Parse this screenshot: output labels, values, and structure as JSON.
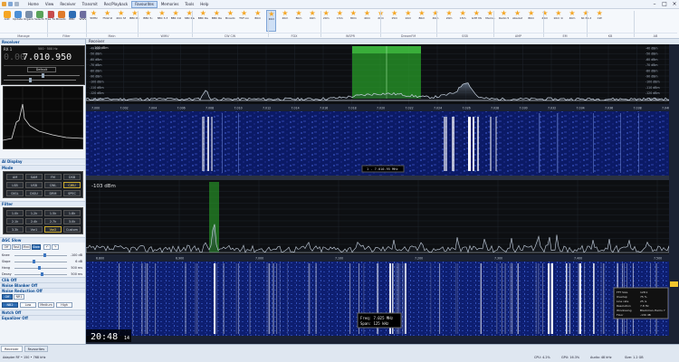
{
  "menu": {
    "items": [
      "Home",
      "View",
      "Receiver",
      "Transmit",
      "Rec/Playback",
      "Favourites",
      "Memories",
      "Tools",
      "Help"
    ],
    "active_index": 5
  },
  "ribbon": {
    "buttons": [
      {
        "label": "Add",
        "icon": "add-star-icon"
      },
      {
        "label": "Update",
        "icon": "update-icon"
      },
      {
        "label": "Organise",
        "icon": "organise-icon"
      },
      {
        "label": "Selection",
        "icon": "selection-icon"
      },
      {
        "label": "Free Tune",
        "icon": "free-tune-icon"
      },
      {
        "label": "Broadcast Amateur",
        "icon": "broadcast-icon"
      },
      {
        "label": "BBC",
        "icon": "bbc-icon"
      },
      {
        "label": "WWV",
        "icon": "wwv-icon"
      },
      {
        "label": "5MHz",
        "icon": "star-icon"
      },
      {
        "label": "7542 kHz",
        "icon": "star-icon"
      },
      {
        "label": "40m SSB",
        "icon": "star-icon"
      },
      {
        "label": "BBC R.4 LW",
        "icon": "star-icon"
      },
      {
        "label": "BBC 5.277",
        "icon": "star-icon"
      },
      {
        "label": "BBC 3.3",
        "icon": "star-icon"
      },
      {
        "label": "BBC 198.5",
        "icon": "star-icon"
      },
      {
        "label": "SBC Radio 1",
        "icon": "star-icon"
      },
      {
        "label": "BBC Radio Cornwall",
        "icon": "star-icon"
      },
      {
        "label": "BBC Radio 2 103.9",
        "icon": "star-icon"
      },
      {
        "label": "Broadcast FM x5",
        "icon": "star-icon"
      },
      {
        "label": "TSF Live",
        "icon": "star-icon"
      },
      {
        "label": "80m",
        "icon": "star-icon"
      },
      {
        "label": "40m",
        "icon": "star-icon"
      },
      {
        "label": "20m",
        "icon": "star-icon"
      },
      {
        "label": "80m",
        "icon": "star-icon"
      },
      {
        "label": "40m",
        "icon": "star-icon"
      },
      {
        "label": "20m",
        "icon": "star-icon"
      },
      {
        "label": "15m",
        "icon": "star-icon"
      },
      {
        "label": "80m",
        "icon": "star-icon"
      },
      {
        "label": "40m",
        "icon": "star-icon"
      },
      {
        "label": "20m",
        "icon": "star-icon"
      },
      {
        "label": "15m",
        "icon": "star-icon"
      },
      {
        "label": "10m",
        "icon": "star-icon"
      },
      {
        "label": "80m",
        "icon": "star-icon"
      },
      {
        "label": "40m",
        "icon": "star-icon"
      },
      {
        "label": "20m",
        "icon": "star-icon"
      },
      {
        "label": "15m",
        "icon": "star-icon"
      },
      {
        "label": "G3H Marina",
        "icon": "star-icon"
      },
      {
        "label": "Marina",
        "icon": "star-icon"
      },
      {
        "label": "Radio 5 Live",
        "icon": "star-icon"
      },
      {
        "label": "Absolute Radio",
        "icon": "star-icon"
      },
      {
        "label": "80m",
        "icon": "star-icon"
      },
      {
        "label": "20m",
        "icon": "star-icon"
      },
      {
        "label": "10m 14.9 MHz",
        "icon": "star-icon"
      },
      {
        "label": "40m",
        "icon": "star-icon"
      },
      {
        "label": "SK 31.2 kHz",
        "icon": "star-icon"
      },
      {
        "label": "CW",
        "icon": "star-icon"
      }
    ],
    "selected_index": 21,
    "groups": [
      "Manage",
      "Filter",
      "Main",
      "WWV",
      "CW CW",
      "FDX",
      "WSPR",
      "DreamFM",
      "SSB",
      "AMP",
      "EM",
      "KB",
      "AB"
    ]
  },
  "leftpanel": {
    "receiver_title": "Receiver",
    "rx_label": "RX 1",
    "vfo_text": "7.010.950",
    "vfo_dim": "0.00",
    "vfo_sub": "500 · 500 Hz",
    "preset": "Default",
    "display_title": "AI Display",
    "mode_title": "Mode",
    "modes": [
      "AM",
      "SAM",
      "FM",
      "DSB",
      "LSB",
      "USB",
      "CWL",
      "CWU",
      "DIGL",
      "DIGU",
      "DRM",
      "SPEC"
    ],
    "active_mode": 7,
    "filter_title": "Filter",
    "filters": [
      "1.0k",
      "1.2k",
      "1.5k",
      "1.8k",
      "2.1k",
      "2.4k",
      "2.7k",
      "3.0k",
      "3.3k",
      "Var1",
      "Var2",
      "Custom"
    ],
    "active_filter": 10,
    "agc_title": "AGC Slow",
    "agc_buttons": [
      "Off",
      "Fast",
      "Med",
      "Slow"
    ],
    "agc_active": 3,
    "sliders": [
      {
        "label": "Knee",
        "value": "-100 dB",
        "pos": 0.55
      },
      {
        "label": "Slope",
        "value": "6 dB",
        "pos": 0.35
      },
      {
        "label": "Hang",
        "value": "500 ms",
        "pos": 0.45
      },
      {
        "label": "Decay",
        "value": "500 ms",
        "pos": 0.5
      }
    ],
    "cw_title": "Clik Off",
    "noise_title": "Noise Blanker Off",
    "nr_title": "Noise Reduction Off",
    "nr_buttons": [
      "Off",
      "NR1"
    ],
    "nb_levels": [
      "NB2",
      "Low",
      "Medium",
      "High"
    ],
    "notch_title": "Notch Off",
    "equalizer_title": "Equalizer Off"
  },
  "panadapter": {
    "title": "Receiver",
    "dbm_label": "-103 dBm",
    "freq_label": "1 - 7.010.95 MHz",
    "levels": [
      "-40 dBm",
      "-50 dBm",
      "-60 dBm",
      "-70 dBm",
      "-80 dBm",
      "-90 dBm",
      "-100 dBm",
      "-110 dBm",
      "-120 dBm",
      "-130 dBm"
    ],
    "freqs": [
      "7.000",
      "7.002",
      "7.004",
      "7.006",
      "7.008",
      "7.010",
      "7.012",
      "7.014",
      "7.016",
      "7.018",
      "7.020",
      "7.022",
      "7.024",
      "7.026",
      "7.028",
      "7.030",
      "7.032",
      "7.034",
      "7.036",
      "7.038",
      "7.040"
    ]
  },
  "wideband": {
    "dbm_label": "-103 dBm",
    "freqs": [
      "6.800",
      "6.900",
      "7.000",
      "7.100",
      "7.200",
      "7.300",
      "7.400",
      "7.500"
    ],
    "clock": "20:48",
    "clock_sec": "14",
    "center_freq": "Freq: 7.025 MHz",
    "span": "Span:  125 kHz",
    "info_rows": [
      [
        "FFT Size",
        "128 k"
      ],
      [
        "Overlap",
        "75 %"
      ],
      [
        "Line rate",
        "25 /s"
      ],
      [
        "Resolution",
        "7.8 Hz"
      ],
      [
        "Windowing",
        "Blackman-Harris 7"
      ],
      [
        "Floor",
        "-130 dB"
      ]
    ]
  },
  "statusbar": {
    "tabs": [
      "Receiver",
      "Favourites"
    ],
    "left_info": "Adapter RF • 150 • 768 kHz",
    "cpu": "CPU: 4.2%",
    "gpu": "GPU: 16.3%",
    "audio": "Audio: 48 kHz",
    "size": "Size: 1.2 GB"
  },
  "colors": {
    "accent": "#2e6db4",
    "spectrum": "#9fb0c6",
    "pass_band": "#2aa52a",
    "waterfall_bg": "#0b1a66"
  }
}
